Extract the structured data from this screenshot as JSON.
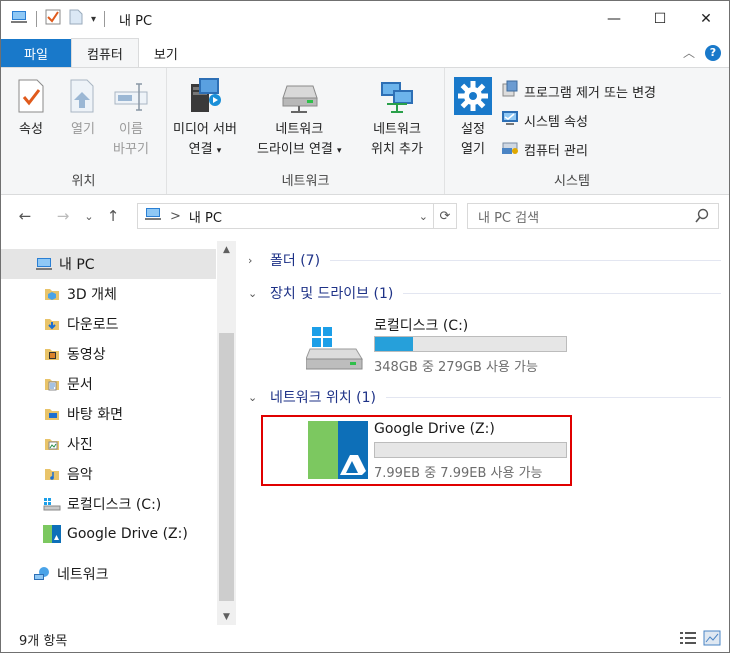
{
  "window": {
    "title": "내 PC",
    "controls": {
      "minimize": "—",
      "maximize": "☐",
      "close": "✕"
    }
  },
  "ribbon": {
    "tabs": [
      {
        "label": "파일",
        "kind": "file"
      },
      {
        "label": "컴퓨터",
        "kind": "active"
      },
      {
        "label": "보기",
        "kind": "normal"
      }
    ],
    "help_label": "?",
    "groups": {
      "location": {
        "label": "위치",
        "properties": "속성",
        "open": "열기",
        "rename_line1": "이름",
        "rename_line2": "바꾸기"
      },
      "network": {
        "label": "네트워크",
        "media_line1": "미디어 서버",
        "media_line2": "연결",
        "map_line1": "네트워크",
        "map_line2": "드라이브 연결",
        "add_line1": "네트워크",
        "add_line2": "위치 추가"
      },
      "system": {
        "label": "시스템",
        "settings_line1": "설정",
        "settings_line2": "열기",
        "uninstall": "프로그램 제거 또는 변경",
        "sysprops": "시스템 속성",
        "manage": "컴퓨터 관리"
      }
    }
  },
  "addressbar": {
    "path_sep": ">",
    "path": "내 PC",
    "search_placeholder": "내 PC 검색"
  },
  "nav": {
    "items": [
      {
        "label": "내 PC",
        "icon": "pc-icon"
      },
      {
        "label": "3D 개체",
        "icon": "3d-objects-icon"
      },
      {
        "label": "다운로드",
        "icon": "downloads-icon"
      },
      {
        "label": "동영상",
        "icon": "videos-icon"
      },
      {
        "label": "문서",
        "icon": "documents-icon"
      },
      {
        "label": "바탕 화면",
        "icon": "desktop-icon"
      },
      {
        "label": "사진",
        "icon": "pictures-icon"
      },
      {
        "label": "음악",
        "icon": "music-icon"
      },
      {
        "label": "로컬디스크 (C:)",
        "icon": "local-disk-icon"
      },
      {
        "label": "Google Drive (Z:)",
        "icon": "google-drive-icon"
      },
      {
        "label": "네트워크",
        "icon": "network-icon"
      }
    ]
  },
  "content": {
    "groups": [
      {
        "label": "폴더 (7)",
        "expanded": false
      },
      {
        "label": "장치 및 드라이브 (1)",
        "expanded": true
      },
      {
        "label": "네트워크 위치 (1)",
        "expanded": true
      }
    ],
    "drives": [
      {
        "name": "로컬디스크 (C:)",
        "free_text": "348GB 중 279GB 사용 가능",
        "used_fraction": 0.2
      },
      {
        "name": "Google Drive (Z:)",
        "free_text": "7.99EB 중 7.99EB 사용 가능",
        "used_fraction": 0.0
      }
    ]
  },
  "status": {
    "item_count": "9개 항목"
  },
  "colors": {
    "accent": "#1979ca",
    "bar_fill": "#26a0da",
    "group_header": "#1e3287",
    "highlight": "#e00000",
    "gdrive_green": "#7cc860",
    "gdrive_blue": "#0d6fb8"
  }
}
